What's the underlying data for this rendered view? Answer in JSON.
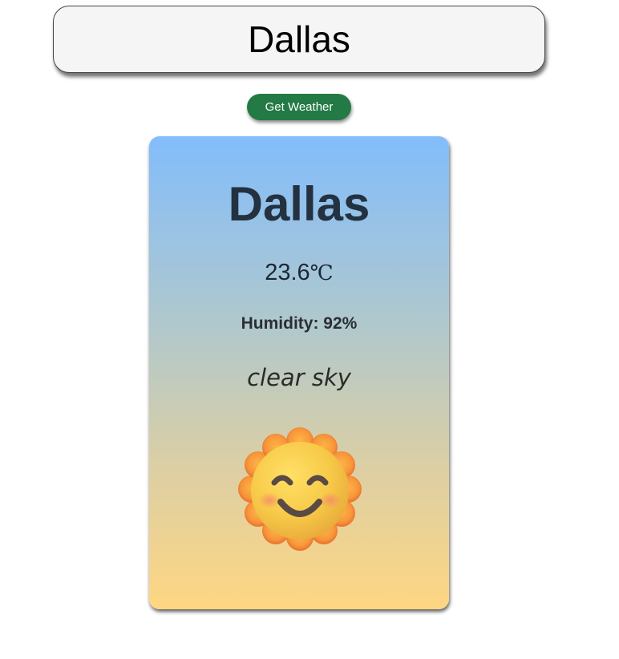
{
  "search": {
    "value": "Dallas"
  },
  "button": {
    "label": "Get Weather"
  },
  "weather": {
    "city": "Dallas",
    "temperature_value": "23.6",
    "temperature_unit": "℃",
    "humidity_text": "Humidity: 92%",
    "description": "clear sky",
    "icon": "smiling-sun-icon"
  },
  "colors": {
    "button_bg": "#237a45",
    "card_gradient_top": "#82bdfc",
    "card_gradient_bottom": "#ffd682",
    "city_text": "#233140"
  }
}
